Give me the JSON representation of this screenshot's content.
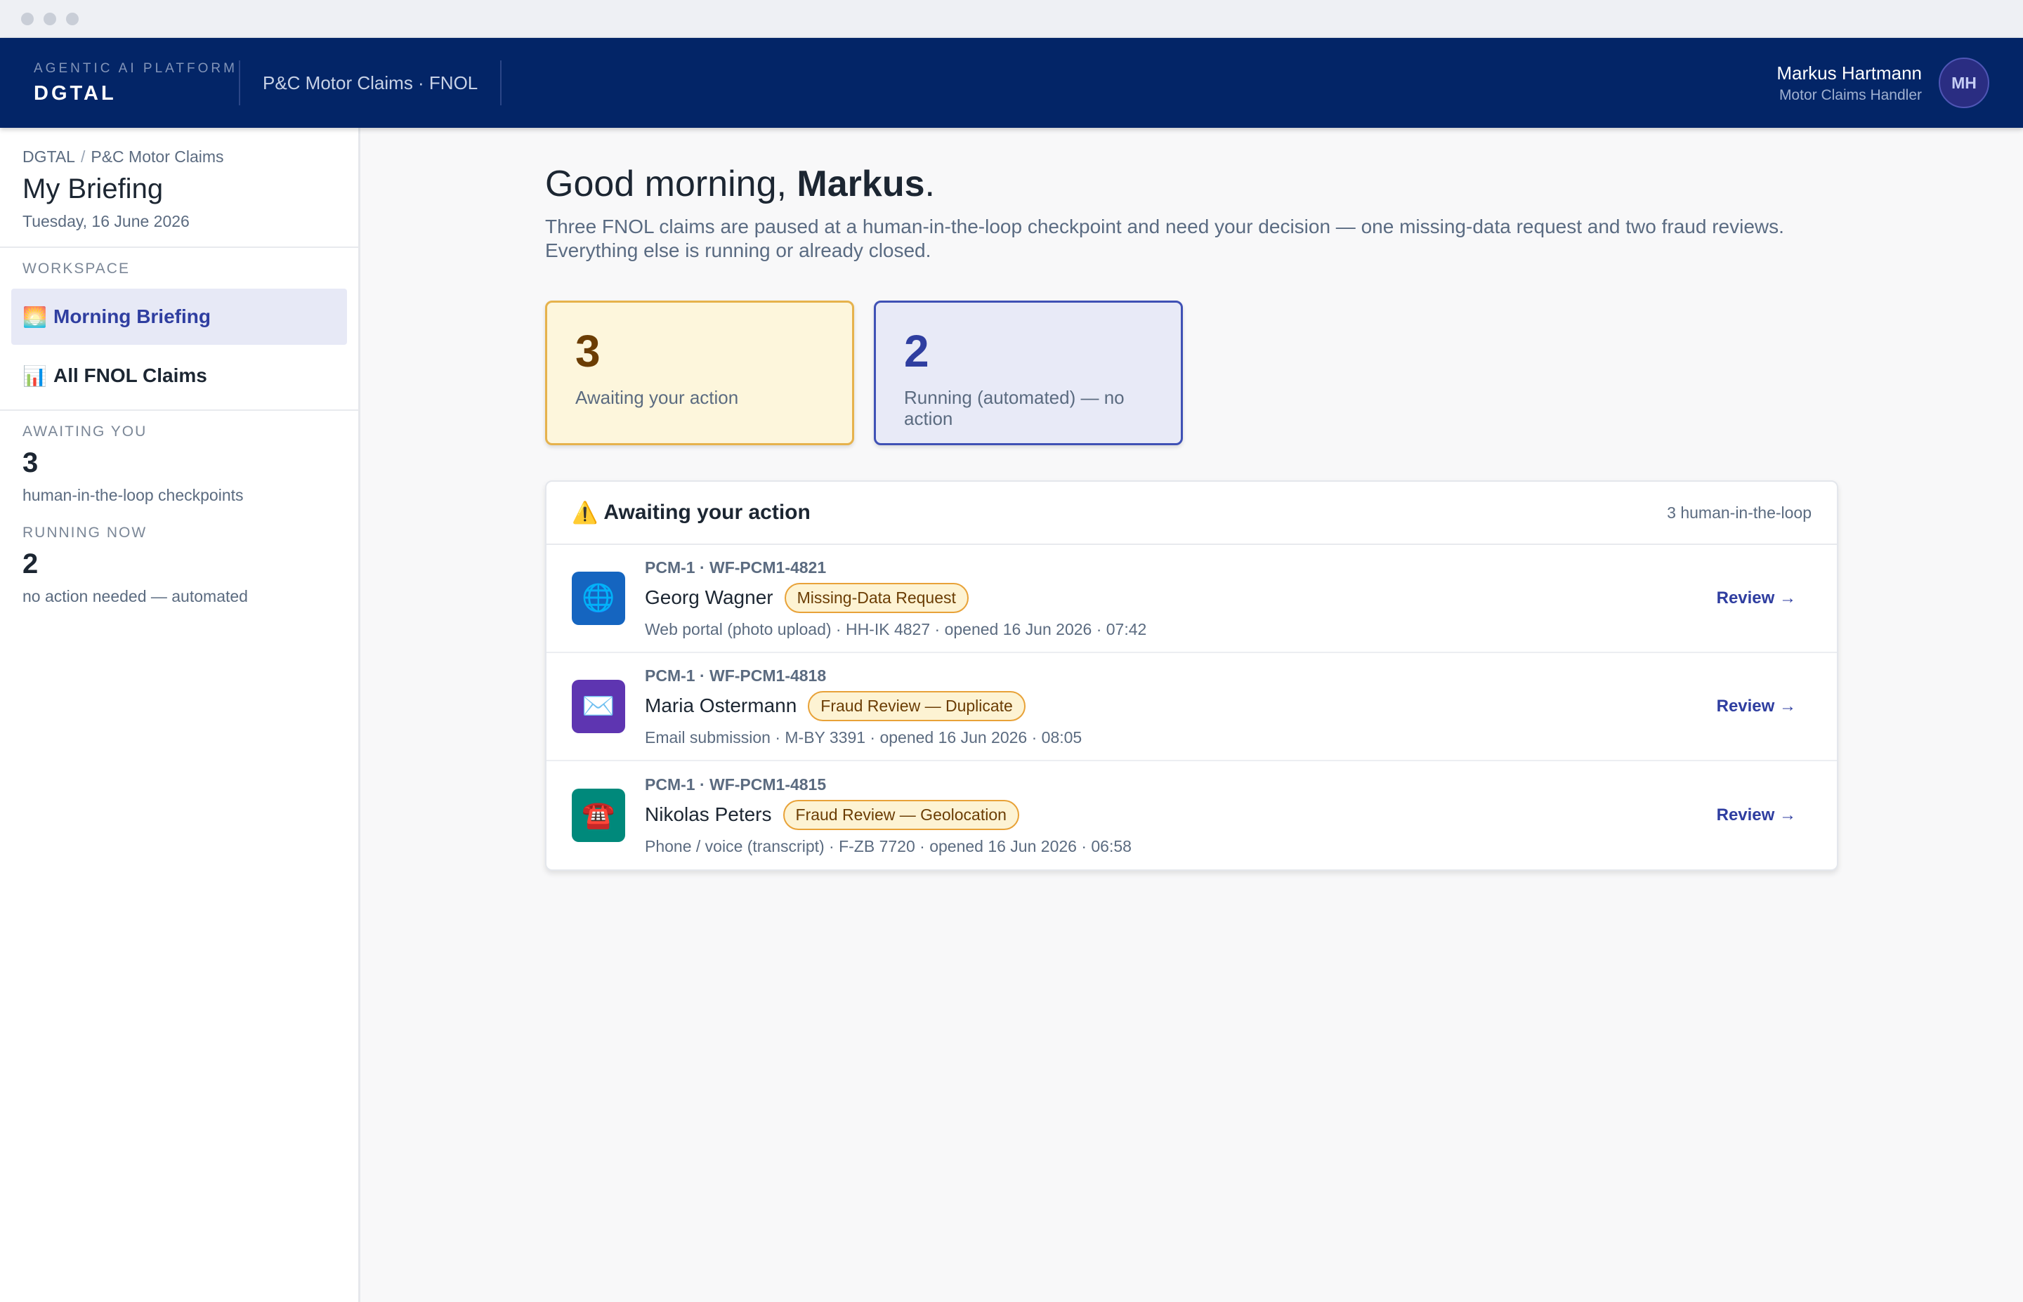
{
  "header": {
    "kicker": "AGENTIC AI PLATFORM",
    "brand": "DGTAL",
    "product": "P&C Motor Claims · FNOL",
    "user_name": "Markus Hartmann",
    "user_role": "Motor Claims Handler",
    "avatar_initials": "MH"
  },
  "sidebar": {
    "breadcrumb": [
      "DGTAL",
      "P&C Motor Claims"
    ],
    "title": "My Briefing",
    "date": "Tuesday, 16 June 2026",
    "workspace_label": "WORKSPACE",
    "nav": [
      {
        "icon": "🌅",
        "icon_name": "sunrise-icon",
        "label": "Morning Briefing",
        "active": true
      },
      {
        "icon": "📊",
        "icon_name": "bar-chart-icon",
        "label": "All FNOL Claims",
        "active": false
      }
    ],
    "awaiting_label": "AWAITING YOU",
    "awaiting_count": "3",
    "awaiting_desc": "human-in-the-loop checkpoints",
    "running_label": "RUNNING NOW",
    "running_count": "2",
    "running_desc": "no action needed — automated"
  },
  "main": {
    "greeting_prefix": "Good morning, ",
    "greeting_name": "Markus",
    "greeting_suffix": ".",
    "intro": "Three FNOL claims are paused at a human-in-the-loop checkpoint and need your decision — one missing-data request and two fraud reviews. Everything else is running or already closed.",
    "cards": [
      {
        "value": "3",
        "label": "Awaiting your action",
        "color": "#e6b24c"
      },
      {
        "value": "2",
        "label": "Running (automated) — no action",
        "color": "#3f51b5"
      }
    ],
    "panel": {
      "icon": "⚠️",
      "title": "Awaiting your action",
      "count": "3 human-in-the-loop",
      "rows": [
        {
          "icon": "🌐",
          "icon_name": "globe-icon",
          "icon_bg": "#1565c0",
          "id": "PCM-1 · WF-PCM1-4821",
          "name": "Georg Wagner",
          "badge": "Missing-Data Request",
          "meta": "Web portal (photo upload) · HH-IK 4827 · opened 16 Jun 2026 · 07:42",
          "action": "Review →"
        },
        {
          "icon": "✉️",
          "icon_name": "envelope-icon",
          "icon_bg": "#5e35b1",
          "id": "PCM-1 · WF-PCM1-4818",
          "name": "Maria Ostermann",
          "badge": "Fraud Review — Duplicate",
          "meta": "Email submission · M-BY 3391 · opened 16 Jun 2026 · 08:05",
          "action": "Review →"
        },
        {
          "icon": "☎️",
          "icon_name": "telephone-icon",
          "icon_bg": "#00897b",
          "id": "PCM-1 · WF-PCM1-4815",
          "name": "Nikolas Peters",
          "badge": "Fraud Review — Geolocation",
          "meta": "Phone / voice (transcript) · F-ZB 7720 · opened 16 Jun 2026 · 06:58",
          "action": "Review →"
        }
      ]
    }
  }
}
